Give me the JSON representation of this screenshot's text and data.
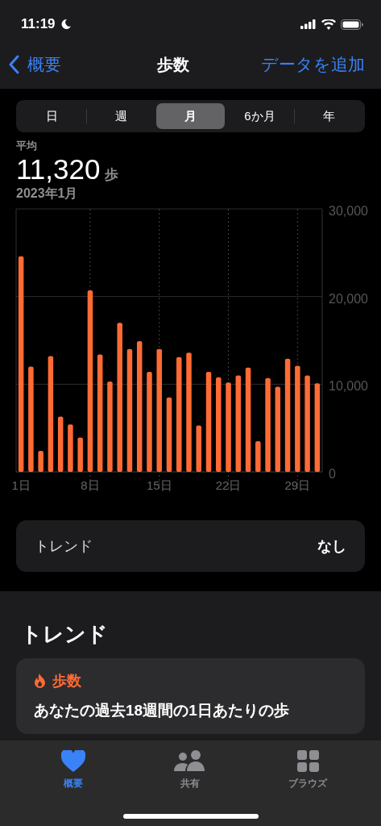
{
  "status_bar": {
    "time": "11:19"
  },
  "nav": {
    "back_label": "概要",
    "title": "歩数",
    "action": "データを追加"
  },
  "segments": [
    {
      "label": "日",
      "selected": false
    },
    {
      "label": "週",
      "selected": false
    },
    {
      "label": "月",
      "selected": true
    },
    {
      "label": "6か月",
      "selected": false
    },
    {
      "label": "年",
      "selected": false
    }
  ],
  "summary": {
    "label": "平均",
    "value": "11,320",
    "unit": "歩",
    "period": "2023年1月"
  },
  "chart": {
    "chart_data": {
      "type": "bar",
      "x": [
        1,
        2,
        3,
        4,
        5,
        6,
        7,
        8,
        9,
        10,
        11,
        12,
        13,
        14,
        15,
        16,
        17,
        18,
        19,
        20,
        21,
        22,
        23,
        24,
        25,
        26,
        27,
        28,
        29,
        30,
        31
      ],
      "series": [
        {
          "color": "#ff6b35",
          "values": [
            24600,
            12000,
            2400,
            13200,
            6300,
            5400,
            3900,
            20700,
            13400,
            10300,
            17000,
            14000,
            14900,
            11400,
            14000,
            8500,
            13100,
            13600,
            5300,
            11400,
            10800,
            10200,
            11000,
            11900,
            3500,
            10700,
            9700,
            12900,
            12100,
            11000,
            10100
          ]
        }
      ],
      "grid": true,
      "xlim": [
        0.5,
        31.5
      ],
      "ylim": [
        0,
        30000
      ],
      "yticks": [
        {
          "value": 0,
          "label": "0"
        },
        {
          "value": 10000,
          "label": "10,000"
        },
        {
          "value": 20000,
          "label": "20,000"
        },
        {
          "value": 30000,
          "label": "30,000"
        }
      ],
      "xticks": [
        {
          "value": 1,
          "label": "1日"
        },
        {
          "value": 8,
          "label": "8日"
        },
        {
          "value": 15,
          "label": "15日"
        },
        {
          "value": 22,
          "label": "22日"
        },
        {
          "value": 29,
          "label": "29日"
        }
      ]
    }
  },
  "trend_row": {
    "label": "トレンド",
    "value": "なし"
  },
  "trends": {
    "heading": "トレンド",
    "card": {
      "category": "歩数",
      "text": "あなたの過去18週間の1日あたりの歩"
    }
  },
  "tab_bar": [
    {
      "label": "概要",
      "selected": true
    },
    {
      "label": "共有",
      "selected": false
    },
    {
      "label": "ブラウズ",
      "selected": false
    }
  ]
}
